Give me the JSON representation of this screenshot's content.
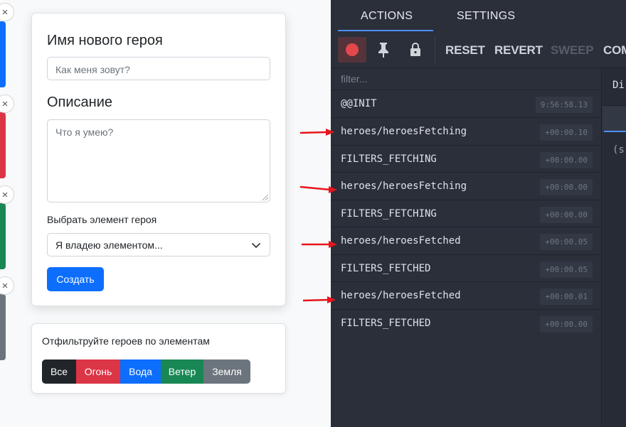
{
  "app": {
    "hero_strips": [
      {
        "color": "#0d6efd"
      },
      {
        "color": "#dc3545"
      },
      {
        "color": "#198754"
      },
      {
        "color": "#6c757d"
      }
    ],
    "close_glyph": "×",
    "form": {
      "name_label": "Имя нового героя",
      "name_placeholder": "Как меня зовут?",
      "description_label": "Описание",
      "description_placeholder": "Что я умею?",
      "element_label": "Выбрать элемент героя",
      "element_selected": "Я владею элементом...",
      "submit_label": "Создать"
    },
    "filters": {
      "title": "Отфильтруйте героев по элементам",
      "buttons": [
        {
          "label": "Все",
          "color": "#212529"
        },
        {
          "label": "Огонь",
          "color": "#dc3545"
        },
        {
          "label": "Вода",
          "color": "#0d6efd"
        },
        {
          "label": "Ветер",
          "color": "#198754"
        },
        {
          "label": "Земля",
          "color": "#6c757d"
        }
      ]
    }
  },
  "devtools": {
    "tabs": [
      "ACTIONS",
      "SETTINGS"
    ],
    "active_tab": "ACTIONS",
    "toolbar": {
      "record_icon": "record-icon",
      "pin_icon": "pin-icon",
      "lock_icon": "lock-icon",
      "reset": "RESET",
      "revert": "REVERT",
      "sweep": "SWEEP",
      "commit": "COM"
    },
    "filter_placeholder": "filter...",
    "actions": [
      {
        "name": "@@INIT",
        "time": "9:56:58.13"
      },
      {
        "name": "heroes/heroesFetching",
        "time": "+00:00.10"
      },
      {
        "name": "FILTERS_FETCHING",
        "time": "+00:00.00"
      },
      {
        "name": "heroes/heroesFetching",
        "time": "+00:00.00"
      },
      {
        "name": "FILTERS_FETCHING",
        "time": "+00:00.00"
      },
      {
        "name": "heroes/heroesFetched",
        "time": "+00:00.05"
      },
      {
        "name": "FILTERS_FETCHED",
        "time": "+00:00.05"
      },
      {
        "name": "heroes/heroesFetched",
        "time": "+00:00.01"
      },
      {
        "name": "FILTERS_FETCHED",
        "time": "+00:00.00"
      }
    ],
    "right_panel": {
      "tab_text": "Di",
      "code_text": "(s"
    }
  },
  "annotations": {
    "arrow_color": "#e8141b"
  }
}
